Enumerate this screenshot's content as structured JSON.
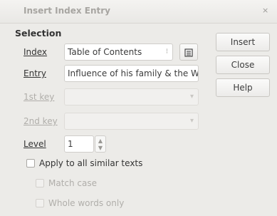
{
  "window": {
    "title": "Insert Index Entry",
    "close_glyph": "×"
  },
  "selection": {
    "section_label": "Selection",
    "index": {
      "label": "Index",
      "value": "Table of Contents",
      "combo_glyph": "⁝"
    },
    "entry": {
      "label": "Entry",
      "value": "Influence of his family & the We"
    },
    "key1": {
      "label": "1st key",
      "value": ""
    },
    "key2": {
      "label": "2nd key",
      "value": ""
    },
    "level": {
      "label": "Level",
      "value": "1"
    },
    "apply_all": {
      "label": "Apply to all similar texts",
      "checked": false
    },
    "match_case": {
      "label": "Match case",
      "checked": false,
      "enabled": false
    },
    "whole_words": {
      "label": "Whole words only",
      "checked": false,
      "enabled": false
    }
  },
  "buttons": {
    "insert": "Insert",
    "close": "Close",
    "help": "Help"
  },
  "icons": {
    "new_index_button": "new-user-defined-index-icon"
  }
}
